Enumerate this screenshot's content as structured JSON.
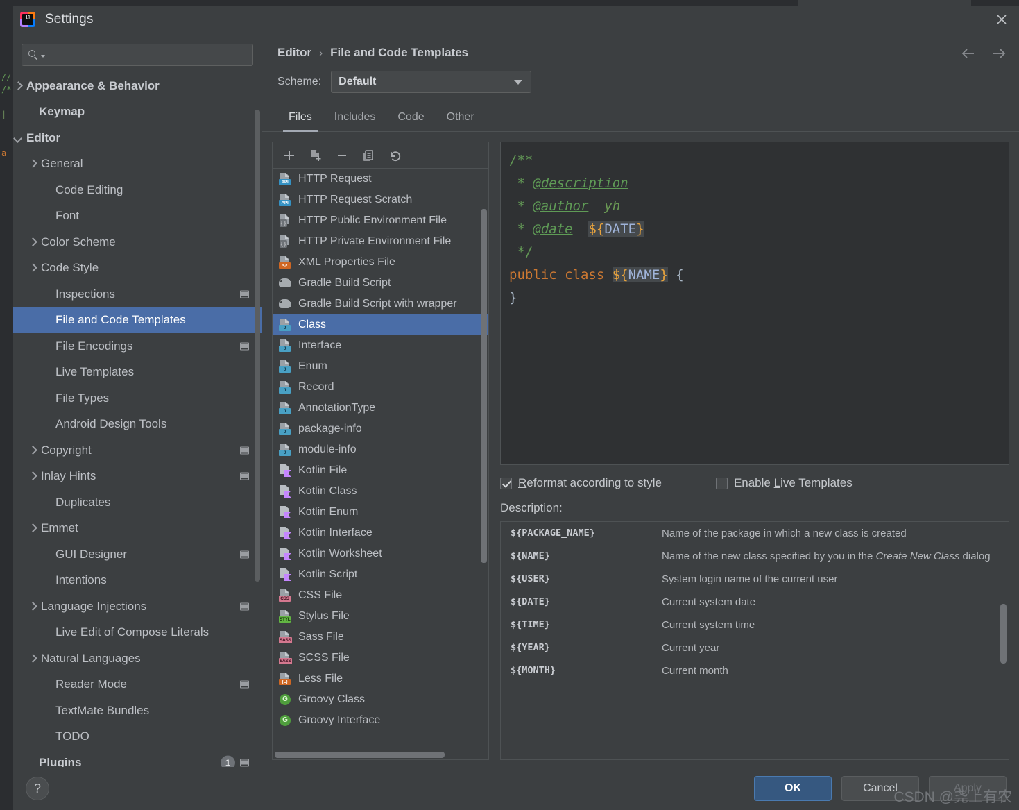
{
  "window": {
    "title": "Settings",
    "logo_text": "IJ",
    "close_icon": "✕"
  },
  "search": {
    "value": "",
    "placeholder": ""
  },
  "sidebar": {
    "items": [
      {
        "label": "Appearance & Behavior",
        "arrow": "right",
        "bold": true,
        "indent": 16,
        "selected": false,
        "badge": false
      },
      {
        "label": "Keymap",
        "arrow": "none",
        "bold": true,
        "indent": 37,
        "selected": false,
        "badge": false
      },
      {
        "label": "Editor",
        "arrow": "down",
        "bold": true,
        "indent": 16,
        "selected": false,
        "badge": false
      },
      {
        "label": "General",
        "arrow": "right",
        "bold": false,
        "indent": 40,
        "selected": false,
        "badge": false
      },
      {
        "label": "Code Editing",
        "arrow": "none",
        "bold": false,
        "indent": 61,
        "selected": false,
        "badge": false
      },
      {
        "label": "Font",
        "arrow": "none",
        "bold": false,
        "indent": 61,
        "selected": false,
        "badge": false
      },
      {
        "label": "Color Scheme",
        "arrow": "right",
        "bold": false,
        "indent": 40,
        "selected": false,
        "badge": false
      },
      {
        "label": "Code Style",
        "arrow": "right",
        "bold": false,
        "indent": 40,
        "selected": false,
        "badge": false
      },
      {
        "label": "Inspections",
        "arrow": "none",
        "bold": false,
        "indent": 61,
        "selected": false,
        "badge": true
      },
      {
        "label": "File and Code Templates",
        "arrow": "none",
        "bold": false,
        "indent": 61,
        "selected": true,
        "badge": false
      },
      {
        "label": "File Encodings",
        "arrow": "none",
        "bold": false,
        "indent": 61,
        "selected": false,
        "badge": true
      },
      {
        "label": "Live Templates",
        "arrow": "none",
        "bold": false,
        "indent": 61,
        "selected": false,
        "badge": false
      },
      {
        "label": "File Types",
        "arrow": "none",
        "bold": false,
        "indent": 61,
        "selected": false,
        "badge": false
      },
      {
        "label": "Android Design Tools",
        "arrow": "none",
        "bold": false,
        "indent": 61,
        "selected": false,
        "badge": false
      },
      {
        "label": "Copyright",
        "arrow": "right",
        "bold": false,
        "indent": 40,
        "selected": false,
        "badge": true
      },
      {
        "label": "Inlay Hints",
        "arrow": "right",
        "bold": false,
        "indent": 40,
        "selected": false,
        "badge": true
      },
      {
        "label": "Duplicates",
        "arrow": "none",
        "bold": false,
        "indent": 61,
        "selected": false,
        "badge": false
      },
      {
        "label": "Emmet",
        "arrow": "right",
        "bold": false,
        "indent": 40,
        "selected": false,
        "badge": false
      },
      {
        "label": "GUI Designer",
        "arrow": "none",
        "bold": false,
        "indent": 61,
        "selected": false,
        "badge": true
      },
      {
        "label": "Intentions",
        "arrow": "none",
        "bold": false,
        "indent": 61,
        "selected": false,
        "badge": false
      },
      {
        "label": "Language Injections",
        "arrow": "right",
        "bold": false,
        "indent": 40,
        "selected": false,
        "badge": true
      },
      {
        "label": "Live Edit of Compose Literals",
        "arrow": "none",
        "bold": false,
        "indent": 61,
        "selected": false,
        "badge": false
      },
      {
        "label": "Natural Languages",
        "arrow": "right",
        "bold": false,
        "indent": 40,
        "selected": false,
        "badge": false
      },
      {
        "label": "Reader Mode",
        "arrow": "none",
        "bold": false,
        "indent": 61,
        "selected": false,
        "badge": true
      },
      {
        "label": "TextMate Bundles",
        "arrow": "none",
        "bold": false,
        "indent": 61,
        "selected": false,
        "badge": false
      },
      {
        "label": "TODO",
        "arrow": "none",
        "bold": false,
        "indent": 61,
        "selected": false,
        "badge": false
      },
      {
        "label": "Plugins",
        "arrow": "none",
        "bold": true,
        "indent": 37,
        "selected": false,
        "badge": true,
        "count": "1"
      }
    ]
  },
  "header": {
    "breadcrumb_parent": "Editor",
    "breadcrumb_sep": "›",
    "breadcrumb_current": "File and Code Templates",
    "back_icon": "←",
    "forward_icon": "→"
  },
  "scheme": {
    "label": "Scheme:",
    "value": "Default"
  },
  "tabs": [
    {
      "label": "Files",
      "active": true
    },
    {
      "label": "Includes",
      "active": false
    },
    {
      "label": "Code",
      "active": false
    },
    {
      "label": "Other",
      "active": false
    }
  ],
  "template_toolbar": [
    {
      "name": "add-template-button",
      "icon": "plus"
    },
    {
      "name": "copy-template-button",
      "icon": "copy-file"
    },
    {
      "name": "remove-template-button",
      "icon": "minus"
    },
    {
      "name": "duplicate-template-button",
      "icon": "duplicate"
    },
    {
      "name": "reset-template-button",
      "icon": "undo"
    }
  ],
  "templates": [
    {
      "label": "HTTP Request",
      "icon": "api-file",
      "selected": false
    },
    {
      "label": "HTTP Request Scratch",
      "icon": "api-file",
      "selected": false
    },
    {
      "label": "HTTP Public Environment File",
      "icon": "env-file",
      "selected": false
    },
    {
      "label": "HTTP Private Environment File",
      "icon": "env-file",
      "selected": false
    },
    {
      "label": "XML Properties File",
      "icon": "xml-file",
      "selected": false
    },
    {
      "label": "Gradle Build Script",
      "icon": "gradle-file",
      "selected": false
    },
    {
      "label": "Gradle Build Script with wrapper",
      "icon": "gradle-file",
      "selected": false
    },
    {
      "label": "Class",
      "icon": "java-file",
      "selected": true
    },
    {
      "label": "Interface",
      "icon": "java-file",
      "selected": false
    },
    {
      "label": "Enum",
      "icon": "java-file",
      "selected": false
    },
    {
      "label": "Record",
      "icon": "java-file",
      "selected": false
    },
    {
      "label": "AnnotationType",
      "icon": "java-file",
      "selected": false
    },
    {
      "label": "package-info",
      "icon": "java-file",
      "selected": false
    },
    {
      "label": "module-info",
      "icon": "java-file",
      "selected": false
    },
    {
      "label": "Kotlin File",
      "icon": "kotlin-file",
      "selected": false
    },
    {
      "label": "Kotlin Class",
      "icon": "kotlin-file",
      "selected": false
    },
    {
      "label": "Kotlin Enum",
      "icon": "kotlin-file",
      "selected": false
    },
    {
      "label": "Kotlin Interface",
      "icon": "kotlin-file",
      "selected": false
    },
    {
      "label": "Kotlin Worksheet",
      "icon": "kotlin-file",
      "selected": false
    },
    {
      "label": "Kotlin Script",
      "icon": "kotlin-file",
      "selected": false
    },
    {
      "label": "CSS File",
      "icon": "css-file",
      "selected": false
    },
    {
      "label": "Stylus File",
      "icon": "stylus-file",
      "selected": false
    },
    {
      "label": "Sass File",
      "icon": "sass-file",
      "selected": false
    },
    {
      "label": "SCSS File",
      "icon": "sass-file",
      "selected": false
    },
    {
      "label": "Less File",
      "icon": "less-file",
      "selected": false
    },
    {
      "label": "Groovy Class",
      "icon": "groovy-file",
      "selected": false
    },
    {
      "label": "Groovy Interface",
      "icon": "groovy-file",
      "selected": false
    }
  ],
  "editor": {
    "lines": [
      {
        "parts": [
          {
            "t": "/**",
            "c": "c-comment"
          }
        ]
      },
      {
        "parts": [
          {
            "t": " * ",
            "c": "c-comment"
          },
          {
            "t": "@description",
            "c": "c-tag"
          }
        ]
      },
      {
        "parts": [
          {
            "t": " * ",
            "c": "c-comment"
          },
          {
            "t": "@author",
            "c": "c-tag"
          },
          {
            "t": "  yh",
            "c": "c-tagtext"
          }
        ]
      },
      {
        "parts": [
          {
            "t": " * ",
            "c": "c-comment"
          },
          {
            "t": "@date",
            "c": "c-tag"
          },
          {
            "t": "  ",
            "c": "c-comment"
          },
          {
            "t": "${DATE}",
            "c": "c-var"
          }
        ]
      },
      {
        "parts": [
          {
            "t": " */",
            "c": "c-comment"
          }
        ]
      },
      {
        "parts": [
          {
            "t": "public class ",
            "c": "c-kw"
          },
          {
            "t": "${NAME}",
            "c": "c-var"
          },
          {
            "t": " {",
            "c": "c-brace"
          }
        ]
      },
      {
        "parts": [
          {
            "t": "}",
            "c": "c-brace"
          }
        ]
      }
    ]
  },
  "options": {
    "reformat": {
      "label_pre": "",
      "label_underline": "R",
      "label_post": "eformat according to style",
      "checked": true
    },
    "live_templates": {
      "label_pre": "Enable ",
      "label_underline": "L",
      "label_post": "ive Templates",
      "checked": false
    }
  },
  "description": {
    "title": "Description:",
    "rows": [
      {
        "key": "${PACKAGE_NAME}",
        "value": "Name of the package in which a new class is created",
        "italic_parts": []
      },
      {
        "key": "${NAME}",
        "value": "Name of the new class specified by you in the ",
        "italic": "Create New Class",
        "value_tail": " dialog"
      },
      {
        "key": "${USER}",
        "value": "System login name of the current user"
      },
      {
        "key": "${DATE}",
        "value": "Current system date"
      },
      {
        "key": "${TIME}",
        "value": "Current system time"
      },
      {
        "key": "${YEAR}",
        "value": "Current year"
      },
      {
        "key": "${MONTH}",
        "value": "Current month"
      }
    ]
  },
  "footer": {
    "help_icon": "?",
    "ok": "OK",
    "cancel": "Cancel",
    "apply": "Apply"
  },
  "watermark": "CSDN @尧上有农",
  "colors": {
    "accent": "#4a6da7",
    "primary_button": "#365880",
    "dialog_bg": "#3c3f41",
    "editor_bg": "#2f3133"
  }
}
